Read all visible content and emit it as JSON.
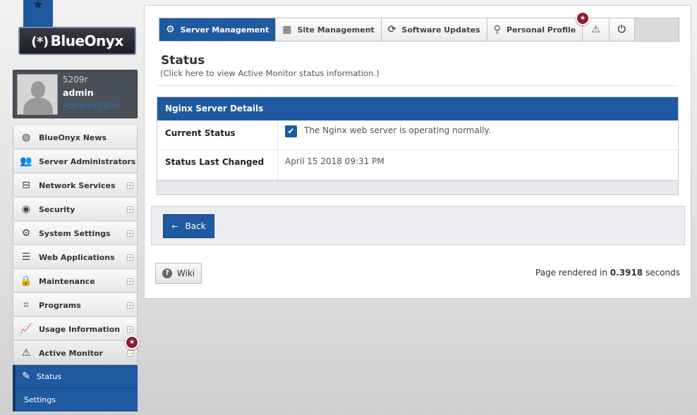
{
  "brand": {
    "logo_symbol": "(*)",
    "logo_text": "BlueOnyx",
    "accent": "#1f5aa0"
  },
  "user": {
    "host": "5209r",
    "name": "admin",
    "role": "Administrator"
  },
  "sidebar": {
    "items": [
      {
        "label": "BlueOnyx News",
        "icon": "globe-icon"
      },
      {
        "label": "Server Administrators",
        "icon": "users-icon"
      },
      {
        "label": "Network Services",
        "icon": "network-icon"
      },
      {
        "label": "Security",
        "icon": "eye-icon"
      },
      {
        "label": "System Settings",
        "icon": "gear-icon"
      },
      {
        "label": "Web Applications",
        "icon": "server-icon"
      },
      {
        "label": "Maintenance",
        "icon": "lock-icon"
      },
      {
        "label": "Programs",
        "icon": "chip-icon"
      },
      {
        "label": "Usage Information",
        "icon": "chart-icon"
      },
      {
        "label": "Active Monitor",
        "icon": "warning-icon"
      }
    ],
    "subitems": [
      {
        "label": "Status",
        "icon": "pencil-icon"
      },
      {
        "label": "Settings"
      }
    ],
    "expand_glyph": "+",
    "collapse_glyph": "−"
  },
  "topnav": {
    "tabs": [
      {
        "label": "Server Management",
        "icon": "gear-icon"
      },
      {
        "label": "Site Management",
        "icon": "layout-icon"
      },
      {
        "label": "Software Updates",
        "icon": "refresh-icon"
      },
      {
        "label": "Personal Profile",
        "icon": "user-icon"
      }
    ]
  },
  "page": {
    "title": "Status",
    "subtitle": "(Click here to view Active Monitor status information.)"
  },
  "details": {
    "header": "Nginx Server Details",
    "rows": [
      {
        "label": "Current Status",
        "value": "The Nginx web server is operating normally."
      },
      {
        "label": "Status Last Changed",
        "value": "April 15 2018 09:31 PM"
      }
    ]
  },
  "buttons": {
    "back": "Back",
    "wiki": "Wiki"
  },
  "footer": {
    "render_prefix": "Page rendered in",
    "render_time": "0.3918",
    "render_suffix": "seconds"
  }
}
